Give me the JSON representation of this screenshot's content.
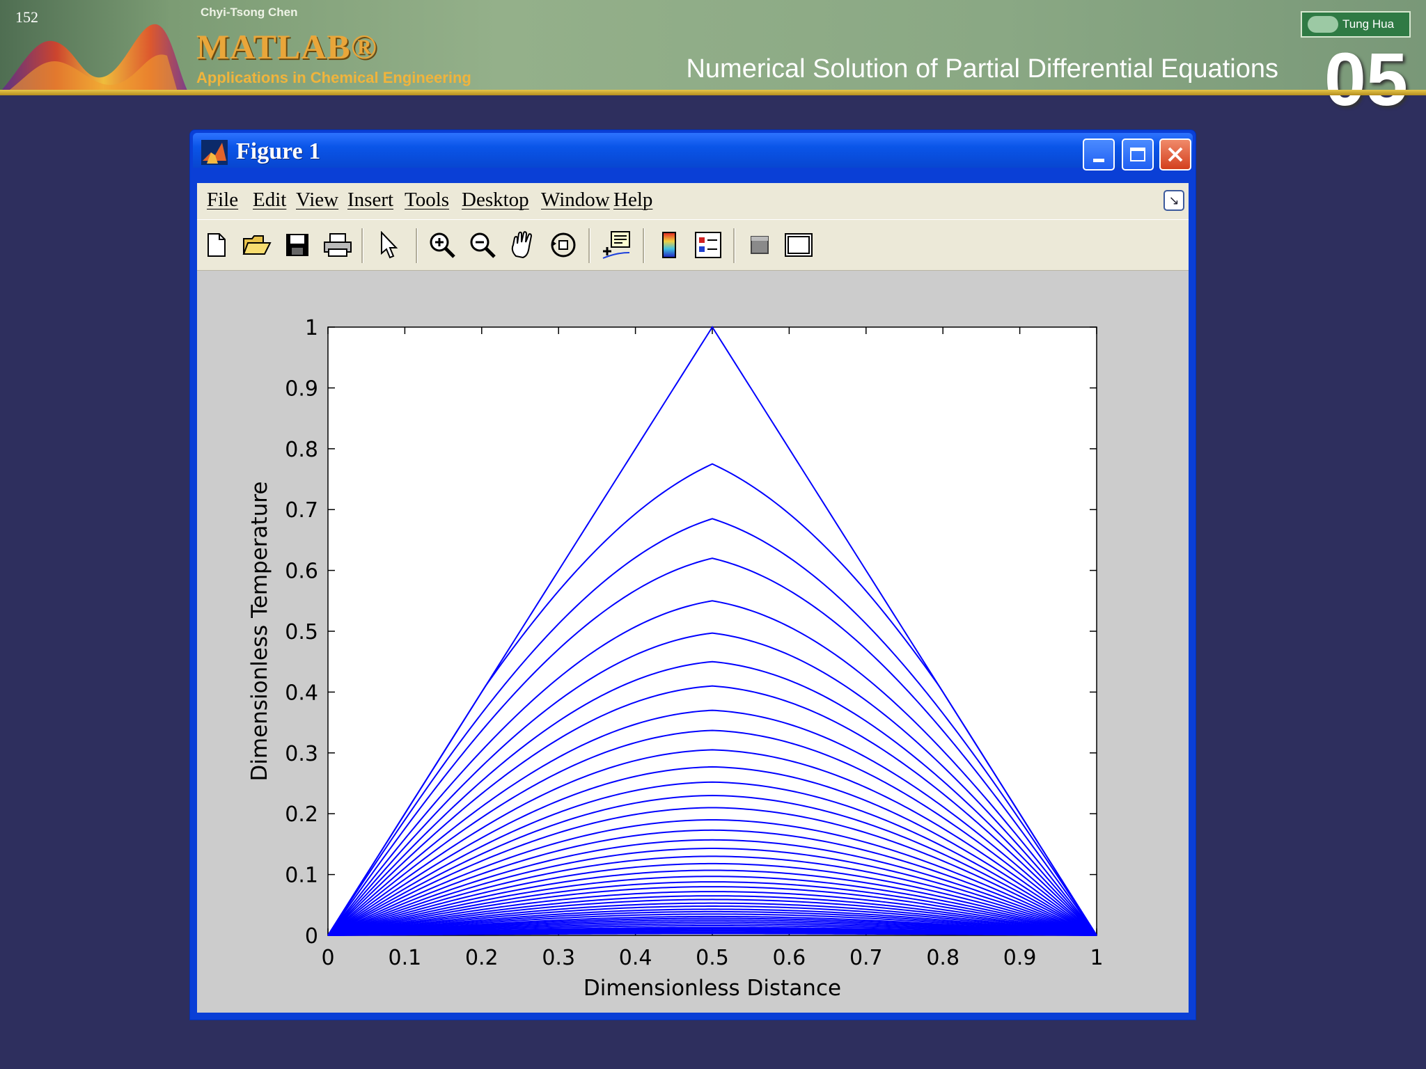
{
  "slide": {
    "page_number": "152",
    "author": "Chyi-Tsong Chen",
    "logo_text": "MATLAB®",
    "tagline": "Applications in Chemical Engineering",
    "title": "Numerical Solution of Partial Differential Equations",
    "chapter": "05",
    "publisher": "Tung Hua"
  },
  "window": {
    "title": "Figure 1",
    "menu": [
      "File",
      "Edit",
      "View",
      "Insert",
      "Tools",
      "Desktop",
      "Window",
      "Help"
    ],
    "toolbar_icons": [
      "new-figure-icon",
      "open-file-icon",
      "save-icon",
      "print-icon",
      "edit-plot-arrow-icon",
      "zoom-in-icon",
      "zoom-out-icon",
      "pan-hand-icon",
      "rotate-3d-icon",
      "data-cursor-icon",
      "insert-colorbar-icon",
      "insert-legend-icon",
      "hide-plot-tools-icon",
      "show-plot-tools-icon"
    ]
  },
  "chart_data": {
    "type": "line",
    "title": "",
    "xlabel": "Dimensionless Distance",
    "ylabel": "Dimensionless Temperature",
    "xlim": [
      0,
      1
    ],
    "ylim": [
      0,
      1
    ],
    "xticks": [
      "0",
      "0.1",
      "0.2",
      "0.3",
      "0.4",
      "0.5",
      "0.6",
      "0.7",
      "0.8",
      "0.9",
      "1"
    ],
    "yticks": [
      "0",
      "0.1",
      "0.2",
      "0.3",
      "0.4",
      "0.5",
      "0.6",
      "0.7",
      "0.8",
      "0.9",
      "1"
    ],
    "line_color": "#0000ff",
    "grid": false,
    "series_description": "temperature profiles u(x,t) over time, initial condition triangular peak at x=0.5",
    "center_values": [
      1.0,
      0.775,
      0.685,
      0.62,
      0.55,
      0.497,
      0.45,
      0.41,
      0.37,
      0.337,
      0.305,
      0.277,
      0.252,
      0.23,
      0.21,
      0.19,
      0.173,
      0.157,
      0.143,
      0.13,
      0.118,
      0.107,
      0.097,
      0.088,
      0.08,
      0.072,
      0.065,
      0.059,
      0.053,
      0.048,
      0.043,
      0.039,
      0.035,
      0.031,
      0.028,
      0.025,
      0.022,
      0.019,
      0.016,
      0.013,
      0.011,
      0.009,
      0.007,
      0.005,
      0.003
    ]
  },
  "colors": {
    "slide_background": "#2e2f5e",
    "window_frame": "#0a3fd6",
    "figure_background": "#cccccc",
    "accent_gold": "#e6c64a"
  }
}
